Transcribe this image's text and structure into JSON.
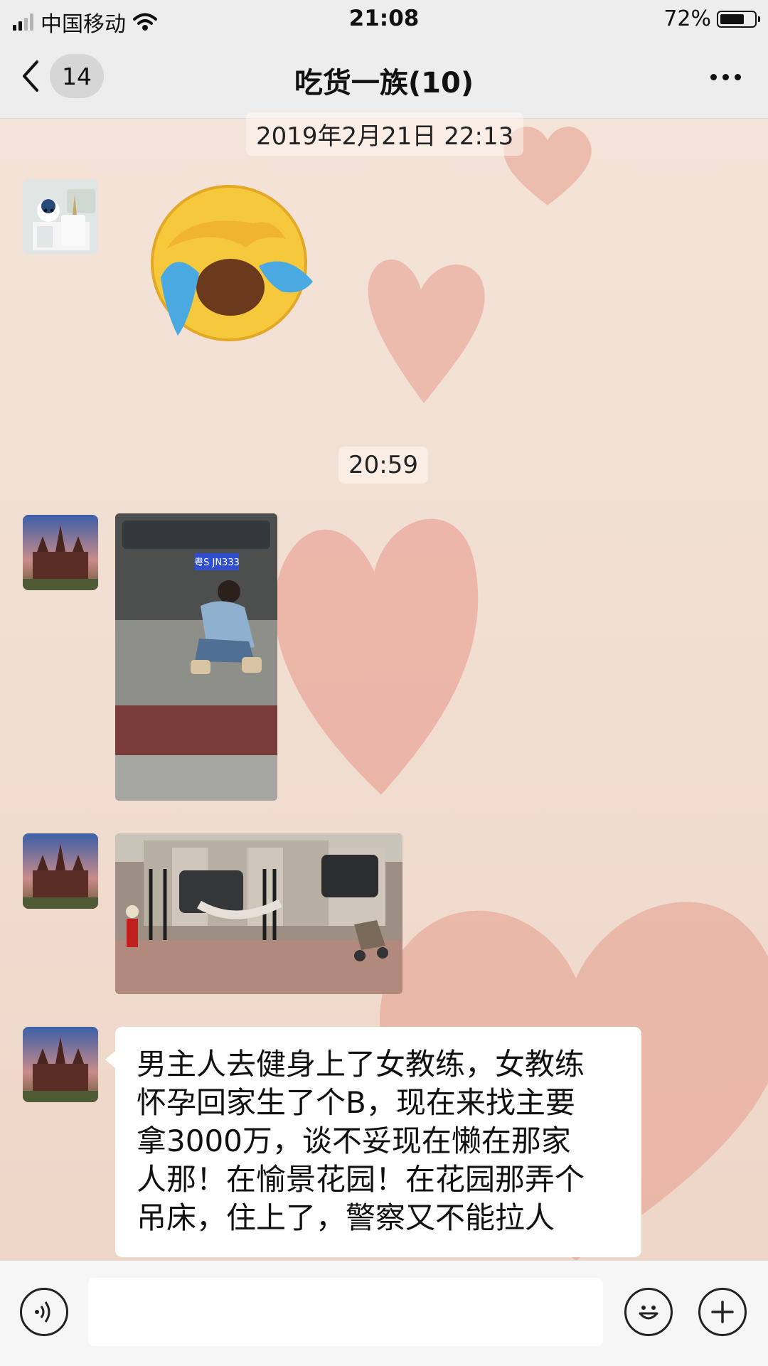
{
  "status_bar": {
    "carrier": "中国移动",
    "time": "21:08",
    "battery_percent": "72%",
    "battery_level": 0.72,
    "signal_bars_filled": 2,
    "signal_bars_total": 4
  },
  "nav": {
    "back_badge": "14",
    "title": "吃货一族(10)",
    "icons": {
      "back": "chevron-left-icon",
      "more": "more-icon"
    }
  },
  "messages": {
    "timestamp_1": "2019年2月21日 22:13",
    "sticker_name": "crying-laughing-emoji",
    "timestamp_2": "20:59",
    "text_message": {
      "lines": [
        "男主人去健身上了女教练，女教练",
        "怀孕回家生了个B，现在来找主要",
        "拿3000万，谈不妥现在懒在那家",
        "人那！在愉景花园！在花园那弄个",
        "吊床，住上了，警察又不能拉人"
      ]
    },
    "photo_1": {
      "plate": "粤S JN333"
    }
  },
  "input_bar": {
    "text_value": "",
    "icons": {
      "voice": "voice-icon",
      "emoji": "emoji-icon",
      "plus": "plus-icon"
    }
  },
  "colors": {
    "bar_bg": "#ededed",
    "wallpaper": "#f3dfd3",
    "heart": "#e7a89a",
    "bubble": "#ffffff"
  }
}
